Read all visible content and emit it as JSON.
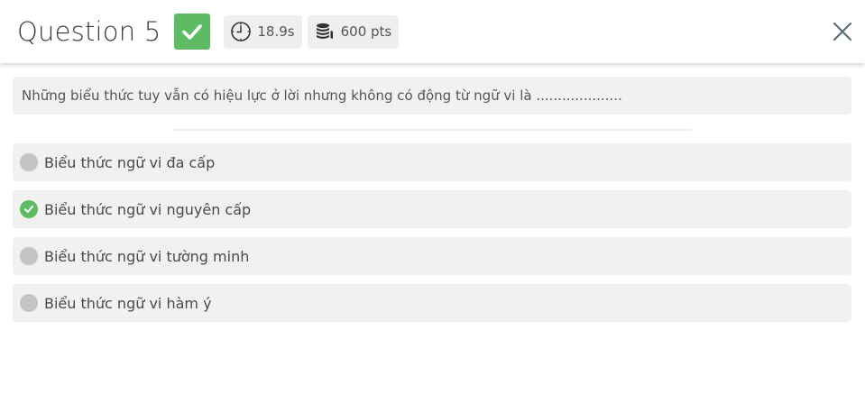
{
  "header": {
    "title": "Question 5",
    "status_icon": "check-icon",
    "timer": {
      "icon": "clock-icon",
      "value": "18.9s"
    },
    "points": {
      "icon": "coins-icon",
      "value": "600 pts"
    },
    "close_icon": "close-icon"
  },
  "question": {
    "text": "Những biểu thức tuy vẫn có hiệu lực ở lời nhưng không có động từ ngữ vi là ...................."
  },
  "options": [
    {
      "label": "Biểu thức ngữ vi đa cấp",
      "correct": false
    },
    {
      "label": "Biểu thức ngữ vi nguyên cấp",
      "correct": true
    },
    {
      "label": "Biểu thức ngữ vi tường minh",
      "correct": false
    },
    {
      "label": "Biểu thức ngữ vi hàm ý",
      "correct": false
    }
  ],
  "colors": {
    "correct_green": "#5dbb63",
    "neutral_marker": "#c4c4c4",
    "panel_bg": "#f1f1f1"
  }
}
